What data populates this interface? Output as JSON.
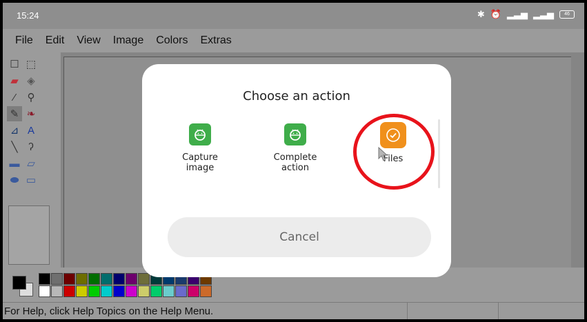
{
  "status_bar": {
    "time": "15:24",
    "battery": "46"
  },
  "menu": [
    "File",
    "Edit",
    "View",
    "Image",
    "Colors",
    "Extras"
  ],
  "tools": [
    {
      "name": "free-select-icon",
      "glyph": "☐"
    },
    {
      "name": "rect-select-icon",
      "glyph": "⬚"
    },
    {
      "name": "eraser-icon",
      "glyph": "▰"
    },
    {
      "name": "fill-icon",
      "glyph": "◈"
    },
    {
      "name": "color-picker-icon",
      "glyph": "⁄"
    },
    {
      "name": "magnifier-icon",
      "glyph": "⚲"
    },
    {
      "name": "pencil-icon",
      "glyph": "✎"
    },
    {
      "name": "brush-icon",
      "glyph": "❧"
    },
    {
      "name": "airbrush-icon",
      "glyph": "⊿"
    },
    {
      "name": "text-icon",
      "glyph": "A"
    },
    {
      "name": "line-icon",
      "glyph": "╲"
    },
    {
      "name": "curve-icon",
      "glyph": "ʔ"
    },
    {
      "name": "rectangle-icon",
      "glyph": "▬"
    },
    {
      "name": "polygon-icon",
      "glyph": "▱"
    },
    {
      "name": "ellipse-icon",
      "glyph": "⬬"
    },
    {
      "name": "rounded-rect-icon",
      "glyph": "▭"
    }
  ],
  "palette": {
    "foreground": "#000000",
    "background": "#dddddd",
    "colors_top": [
      "#000000",
      "#6f6f6f",
      "#6d0000",
      "#6d6d00",
      "#006d00",
      "#006d6d",
      "#00006d",
      "#6d006d",
      "#6d6d3a",
      "#003a3a",
      "#003a6d",
      "#1a3a6d",
      "#3a006d",
      "#6d3a00"
    ],
    "colors_bottom": [
      "#ffffff",
      "#b8b8b8",
      "#cc0000",
      "#cccc00",
      "#00cc00",
      "#00cccc",
      "#0000cc",
      "#cc00cc",
      "#cccc6a",
      "#00cc6a",
      "#6acccc",
      "#6a6acc",
      "#cc006a",
      "#cc6a2a"
    ]
  },
  "help_text": "For Help, click Help Topics on the Help Menu.",
  "dialog": {
    "title": "Choose an action",
    "apps": [
      {
        "label_line1": "Capture",
        "label_line2": "image",
        "color": "#3fad4a"
      },
      {
        "label_line1": "Complete",
        "label_line2": "action",
        "color": "#3fad4a"
      },
      {
        "label_line1": "Files",
        "label_line2": "",
        "color": "#f0901c"
      }
    ],
    "cancel_label": "Cancel"
  },
  "colors": {
    "highlight_ring": "#e8131b",
    "app_green": "#3fad4a",
    "app_orange": "#f0901c"
  }
}
